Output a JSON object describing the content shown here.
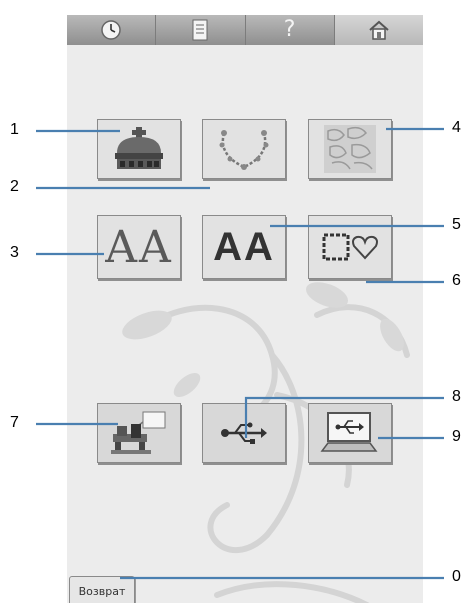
{
  "topbar": {
    "buttons": [
      {
        "name": "clock-icon"
      },
      {
        "name": "document-icon"
      },
      {
        "name": "help-icon",
        "glyph": "?"
      },
      {
        "name": "home-icon"
      }
    ]
  },
  "tiles": [
    {
      "name": "crown-icon"
    },
    {
      "name": "floral-wreath-icon"
    },
    {
      "name": "quilt-pattern-icon"
    },
    {
      "name": "decorative-alphabet-icon",
      "text": "AA"
    },
    {
      "name": "character-font-icon",
      "text": "AA"
    },
    {
      "name": "frame-shapes-icon"
    },
    {
      "name": "embroidery-machine-icon"
    },
    {
      "name": "usb-icon"
    },
    {
      "name": "computer-usb-icon"
    }
  ],
  "callouts": [
    "1",
    "2",
    "3",
    "4",
    "5",
    "6",
    "7",
    "8",
    "9",
    "0"
  ],
  "back_button": {
    "label": "Возврат"
  },
  "colors": {
    "screen_bg": "#ececec",
    "topbar": "#9a9a9a",
    "callout_line": "#4a7fb0"
  }
}
